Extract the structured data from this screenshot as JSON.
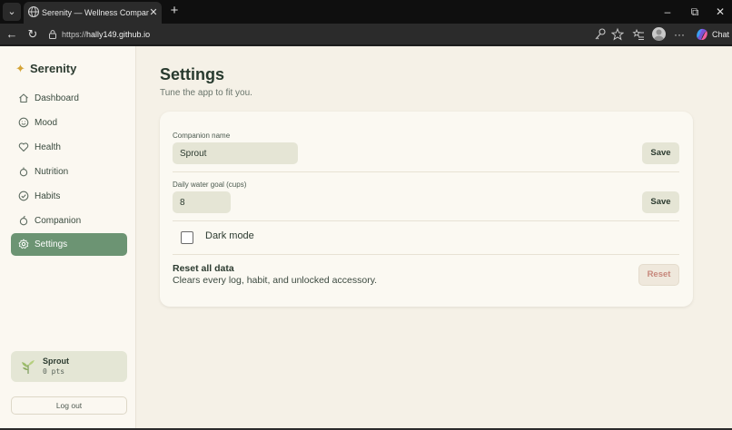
{
  "browser": {
    "tab_title": "Serenity — Wellness Companion",
    "url_prefix": "https://",
    "url_host": "hally149.github.io",
    "chat_label": "Chat"
  },
  "sidebar": {
    "brand": "Serenity",
    "items": [
      {
        "label": "Dashboard",
        "icon": "home-icon"
      },
      {
        "label": "Mood",
        "icon": "smile-icon"
      },
      {
        "label": "Health",
        "icon": "heart-icon"
      },
      {
        "label": "Nutrition",
        "icon": "apple-icon"
      },
      {
        "label": "Habits",
        "icon": "check-circle-icon"
      },
      {
        "label": "Companion",
        "icon": "sprout-icon"
      },
      {
        "label": "Settings",
        "icon": "gear-icon",
        "active": true
      }
    ],
    "profile": {
      "name": "Sprout",
      "points": "0 pts"
    },
    "logout_label": "Log out"
  },
  "page": {
    "title": "Settings",
    "subtitle": "Tune the app to fit you."
  },
  "settings": {
    "companion_name": {
      "label": "Companion name",
      "value": "Sprout",
      "button": "Save"
    },
    "water_goal": {
      "label": "Daily water goal (cups)",
      "value": "8",
      "button": "Save"
    },
    "dark_mode": {
      "label": "Dark mode",
      "checked": false
    },
    "reset": {
      "title": "Reset all data",
      "description": "Clears every log, habit, and unlocked accessory.",
      "button": "Reset"
    }
  },
  "colors": {
    "accent": "#6c9473",
    "brand_star": "#d4a437",
    "danger_text": "#c7877b",
    "background": "#f5f1e7"
  }
}
